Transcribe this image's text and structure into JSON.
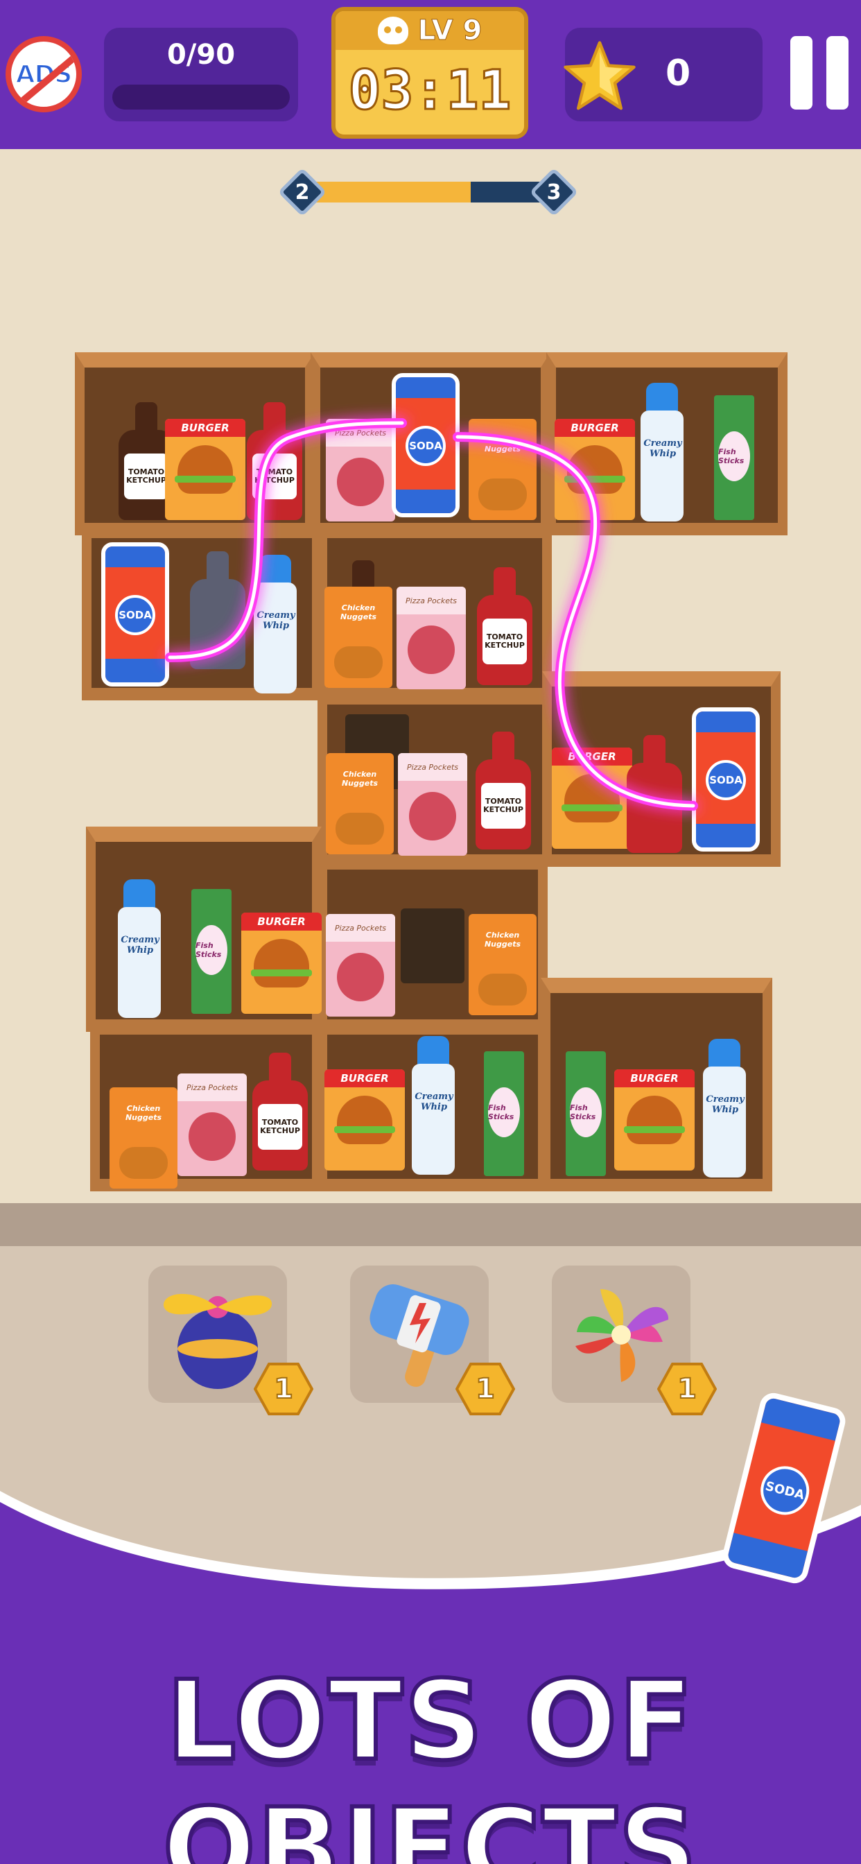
{
  "hud": {
    "ads_label": "ADS",
    "progress_text": "0/90",
    "progress_value": 0,
    "level_label": "LV 9",
    "timer": "03:11",
    "stars": "0"
  },
  "stage": {
    "from": "2",
    "to": "3",
    "progress": 0.68
  },
  "products": {
    "soda_label": "SODA",
    "ketchup_label_1": "TOMATO",
    "ketchup_label_2": "KETCHUP",
    "whip_label": "Creamy Whip",
    "burger_label": "BURGER",
    "nuggets_label": "Chicken Nuggets",
    "pizza_label": "Pizza Pockets",
    "sticks_label": "Fish Sticks"
  },
  "boosters": [
    {
      "icon": "propeller-bomb-icon",
      "count": "1"
    },
    {
      "icon": "hammer-icon",
      "count": "1"
    },
    {
      "icon": "pinwheel-icon",
      "count": "1"
    }
  ],
  "banner": "LOTS OF OBJECTS",
  "colors": {
    "topbar": "#6a2fb6",
    "panel": "#52259a",
    "timer": "#f7c84b",
    "glow": "#ff3df2",
    "shelf_wood": "#b8783f",
    "background": "#ebdfc8"
  }
}
